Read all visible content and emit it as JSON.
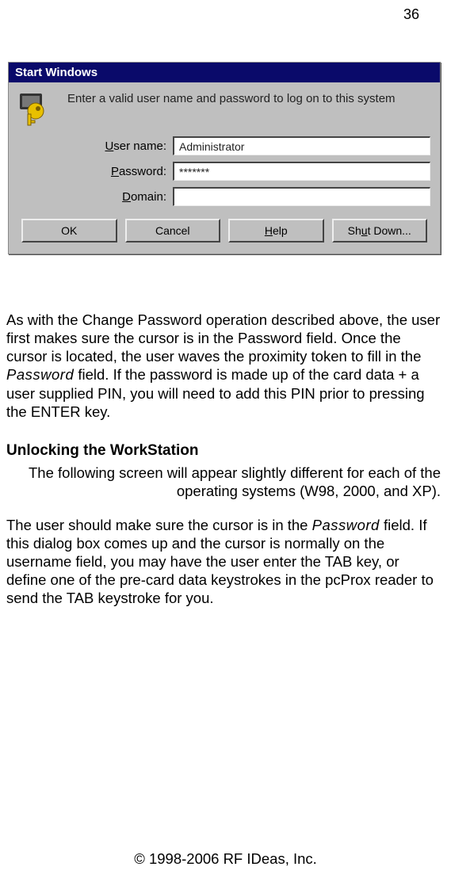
{
  "page_number": "36",
  "dialog": {
    "title": "Start Windows",
    "instruction": "Enter a valid user name and password to log on to this system",
    "username_label_pre": "U",
    "username_label_post": "ser name:",
    "username_value": "Administrator",
    "password_label_pre": "P",
    "password_label_post": "assword:",
    "password_value": "*******",
    "domain_label_pre": "",
    "domain_label_u": "D",
    "domain_label_post": "omain:",
    "domain_value": "",
    "buttons": {
      "ok": "OK",
      "cancel": "Cancel",
      "help_u": "H",
      "help_rest": "elp",
      "shutdown_pre": "Sh",
      "shutdown_u": "u",
      "shutdown_post": "t Down..."
    }
  },
  "para1_a": "As with the Change Password operation described above, the user first makes sure the cursor is in the Password field. Once the cursor is located, the user waves the proximity token to fill in the ",
  "para1_pw": "Password",
  "para1_b": " field. If the password is made up of the card data + a user supplied PIN, you will need to add this PIN prior to pressing the ENTER key.",
  "heading": "Unlocking the WorkStation",
  "para2": "The following screen will appear slightly different for each of the operating systems (W98, 2000, and XP).",
  "para3_a": "The user should make sure the cursor is in the ",
  "para3_pw": "Password",
  "para3_b": " field. If this dialog box comes up and the cursor is normally on the username field, you may have the user enter the TAB key, or define one of the pre-card data keystrokes in the pcProx reader to send the TAB keystroke for you.",
  "footer": "© 1998-2006 RF IDeas, Inc."
}
